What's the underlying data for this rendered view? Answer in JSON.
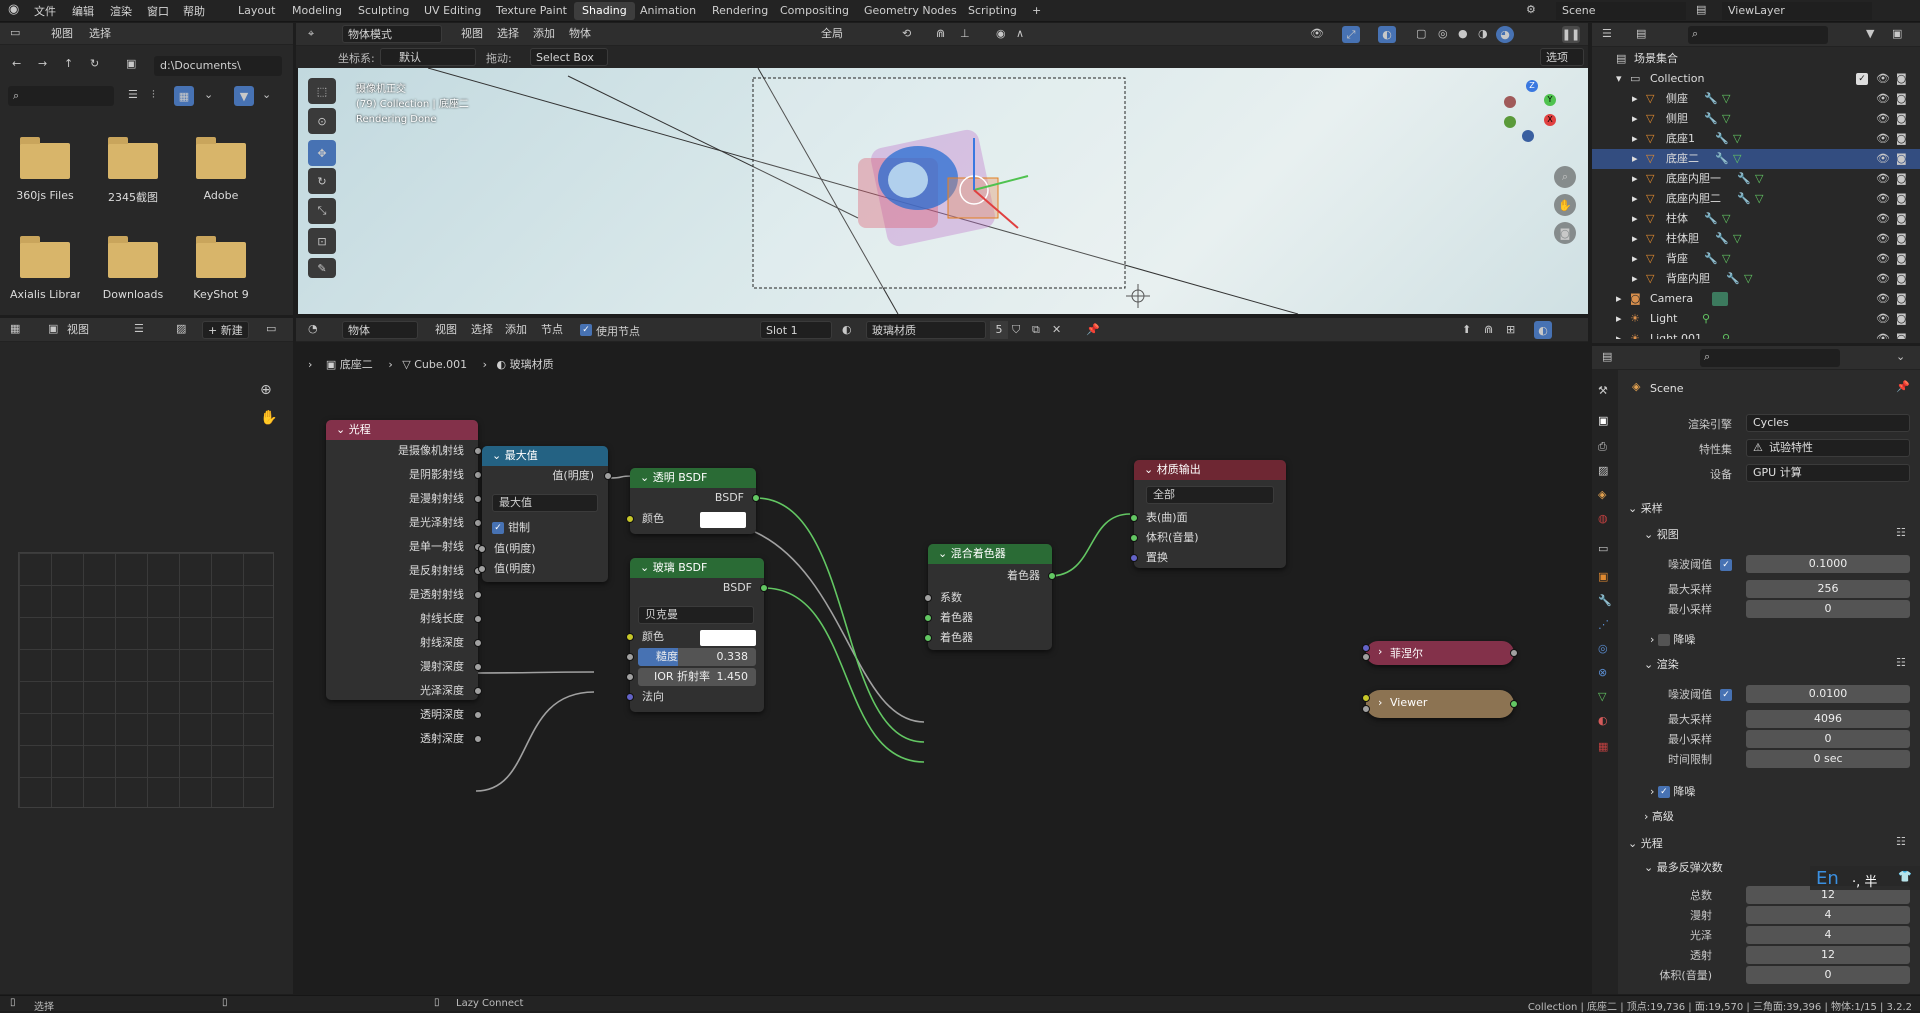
{
  "topbar": {
    "menus": [
      "文件",
      "编辑",
      "渲染",
      "窗口",
      "帮助"
    ],
    "workspaces": [
      "Layout",
      "Modeling",
      "Sculpting",
      "UV Editing",
      "Texture Paint",
      "Shading",
      "Animation",
      "Rendering",
      "Compositing",
      "Geometry Nodes",
      "Scripting"
    ],
    "active_workspace": "Shading",
    "scene": "Scene",
    "view_layer": "ViewLayer"
  },
  "filebrowser": {
    "menu_view": "视图",
    "menu_select": "选择",
    "path": "d:\\Documents\\",
    "folders": [
      "360js Files",
      "2345截图",
      "Adobe",
      "Axialis Librari...",
      "Downloads",
      "KeyShot 9"
    ]
  },
  "imageeditor": {
    "menu_view": "视图",
    "new_label": "新建"
  },
  "viewport": {
    "mode": "物体模式",
    "menus": [
      "视图",
      "选择",
      "添加",
      "物体"
    ],
    "global": "全局",
    "coord_label": "坐标系:",
    "coord_value": "默认",
    "drag_label": "拖动:",
    "drag_value": "Select Box",
    "options": "选项",
    "info_line1": "摄像机正交",
    "info_line2": "(79) Collection | 底座二",
    "info_line3": "Rendering Done"
  },
  "nodeheader": {
    "object": "物体",
    "menus": [
      "视图",
      "选择",
      "添加",
      "节点"
    ],
    "use_nodes": "使用节点",
    "slot": "Slot 1",
    "material": "玻璃材质",
    "users": "5"
  },
  "breadcrumb": [
    "底座二",
    "Cube.001",
    "玻璃材质"
  ],
  "nodes": {
    "lightpath": {
      "title": "光程",
      "outputs": [
        "是摄像机射线",
        "是阴影射线",
        "是漫射射线",
        "是光泽射线",
        "是单一射线",
        "是反射射线",
        "是透射射线",
        "射线长度",
        "射线深度",
        "漫射深度",
        "光泽深度",
        "透明深度",
        "透射深度"
      ]
    },
    "max": {
      "title": "最大值",
      "output": "值(明度)",
      "op": "最大值",
      "clamp": "钳制",
      "in1": "值(明度)",
      "in2": "值(明度)"
    },
    "transparent": {
      "title": "透明 BSDF",
      "output": "BSDF",
      "color_label": "颜色"
    },
    "glass": {
      "title": "玻璃 BSDF",
      "output": "BSDF",
      "dist": "贝克曼",
      "color_label": "颜色",
      "rough_label": "糙度",
      "rough_value": "0.338",
      "rough_fraction": 0.338,
      "ior_label": "IOR 折射率",
      "ior_value": "1.450",
      "normal_label": "法向"
    },
    "mix": {
      "title": "混合着色器",
      "output": "着色器",
      "fac": "系数",
      "in1": "着色器",
      "in2": "着色器"
    },
    "output": {
      "title": "材质输出",
      "target": "全部",
      "surface": "表(曲)面",
      "volume": "体积(音量)",
      "displacement": "置换"
    },
    "fresnel": {
      "title": "菲涅尔"
    },
    "viewer": {
      "title": "Viewer"
    }
  },
  "outliner": {
    "root": "场景集合",
    "collection": "Collection",
    "items": [
      "侧座",
      "侧胆",
      "底座1",
      "底座二",
      "底座内胆一",
      "底座内胆二",
      "柱体",
      "柱体胆",
      "背座",
      "背座内胆"
    ],
    "selected": "底座二",
    "camera": "Camera",
    "light": "Light",
    "light2": "Light.001"
  },
  "properties": {
    "scene": "Scene",
    "engine_label": "渲染引擎",
    "engine": "Cycles",
    "feature_label": "特性集",
    "feature": "试验特性",
    "device_label": "设备",
    "device": "GPU 计算",
    "sampling": "采样",
    "viewport": "视图",
    "noise_label": "噪波阈值",
    "vp_noise": "0.1000",
    "max_label": "最大采样",
    "vp_max": "256",
    "min_label": "最小采样",
    "vp_min": "0",
    "denoise": "降噪",
    "render": "渲染",
    "r_noise": "0.0100",
    "r_max": "4096",
    "r_min": "0",
    "time_label": "时间限制",
    "r_time": "0 sec",
    "advanced": "高级",
    "lightpaths": "光程",
    "max_bounces": "最多反弹次数",
    "total_label": "总数",
    "total": "12",
    "diffuse_label": "漫射",
    "diffuse": "4",
    "glossy_label": "光泽",
    "glossy": "4",
    "trans_label": "透射",
    "trans": "12",
    "volume_label": "体积(音量)",
    "volume": "0"
  },
  "ime": {
    "label": "En",
    "extra": "·, 半"
  },
  "statusbar": {
    "select": "选择",
    "lazy": "Lazy Connect",
    "stats": "Collection | 底座二 | 顶点:19,736 | 面:19,570 | 三角面:39,396 | 物体:1/15 | 3.2.2"
  },
  "colors": {
    "accent": "#4772b3",
    "selection": "#334d80",
    "shader_socket": "#63c763",
    "value_socket": "#a1a1a1",
    "color_socket": "#c7c729",
    "vector_socket": "#6363c7"
  }
}
